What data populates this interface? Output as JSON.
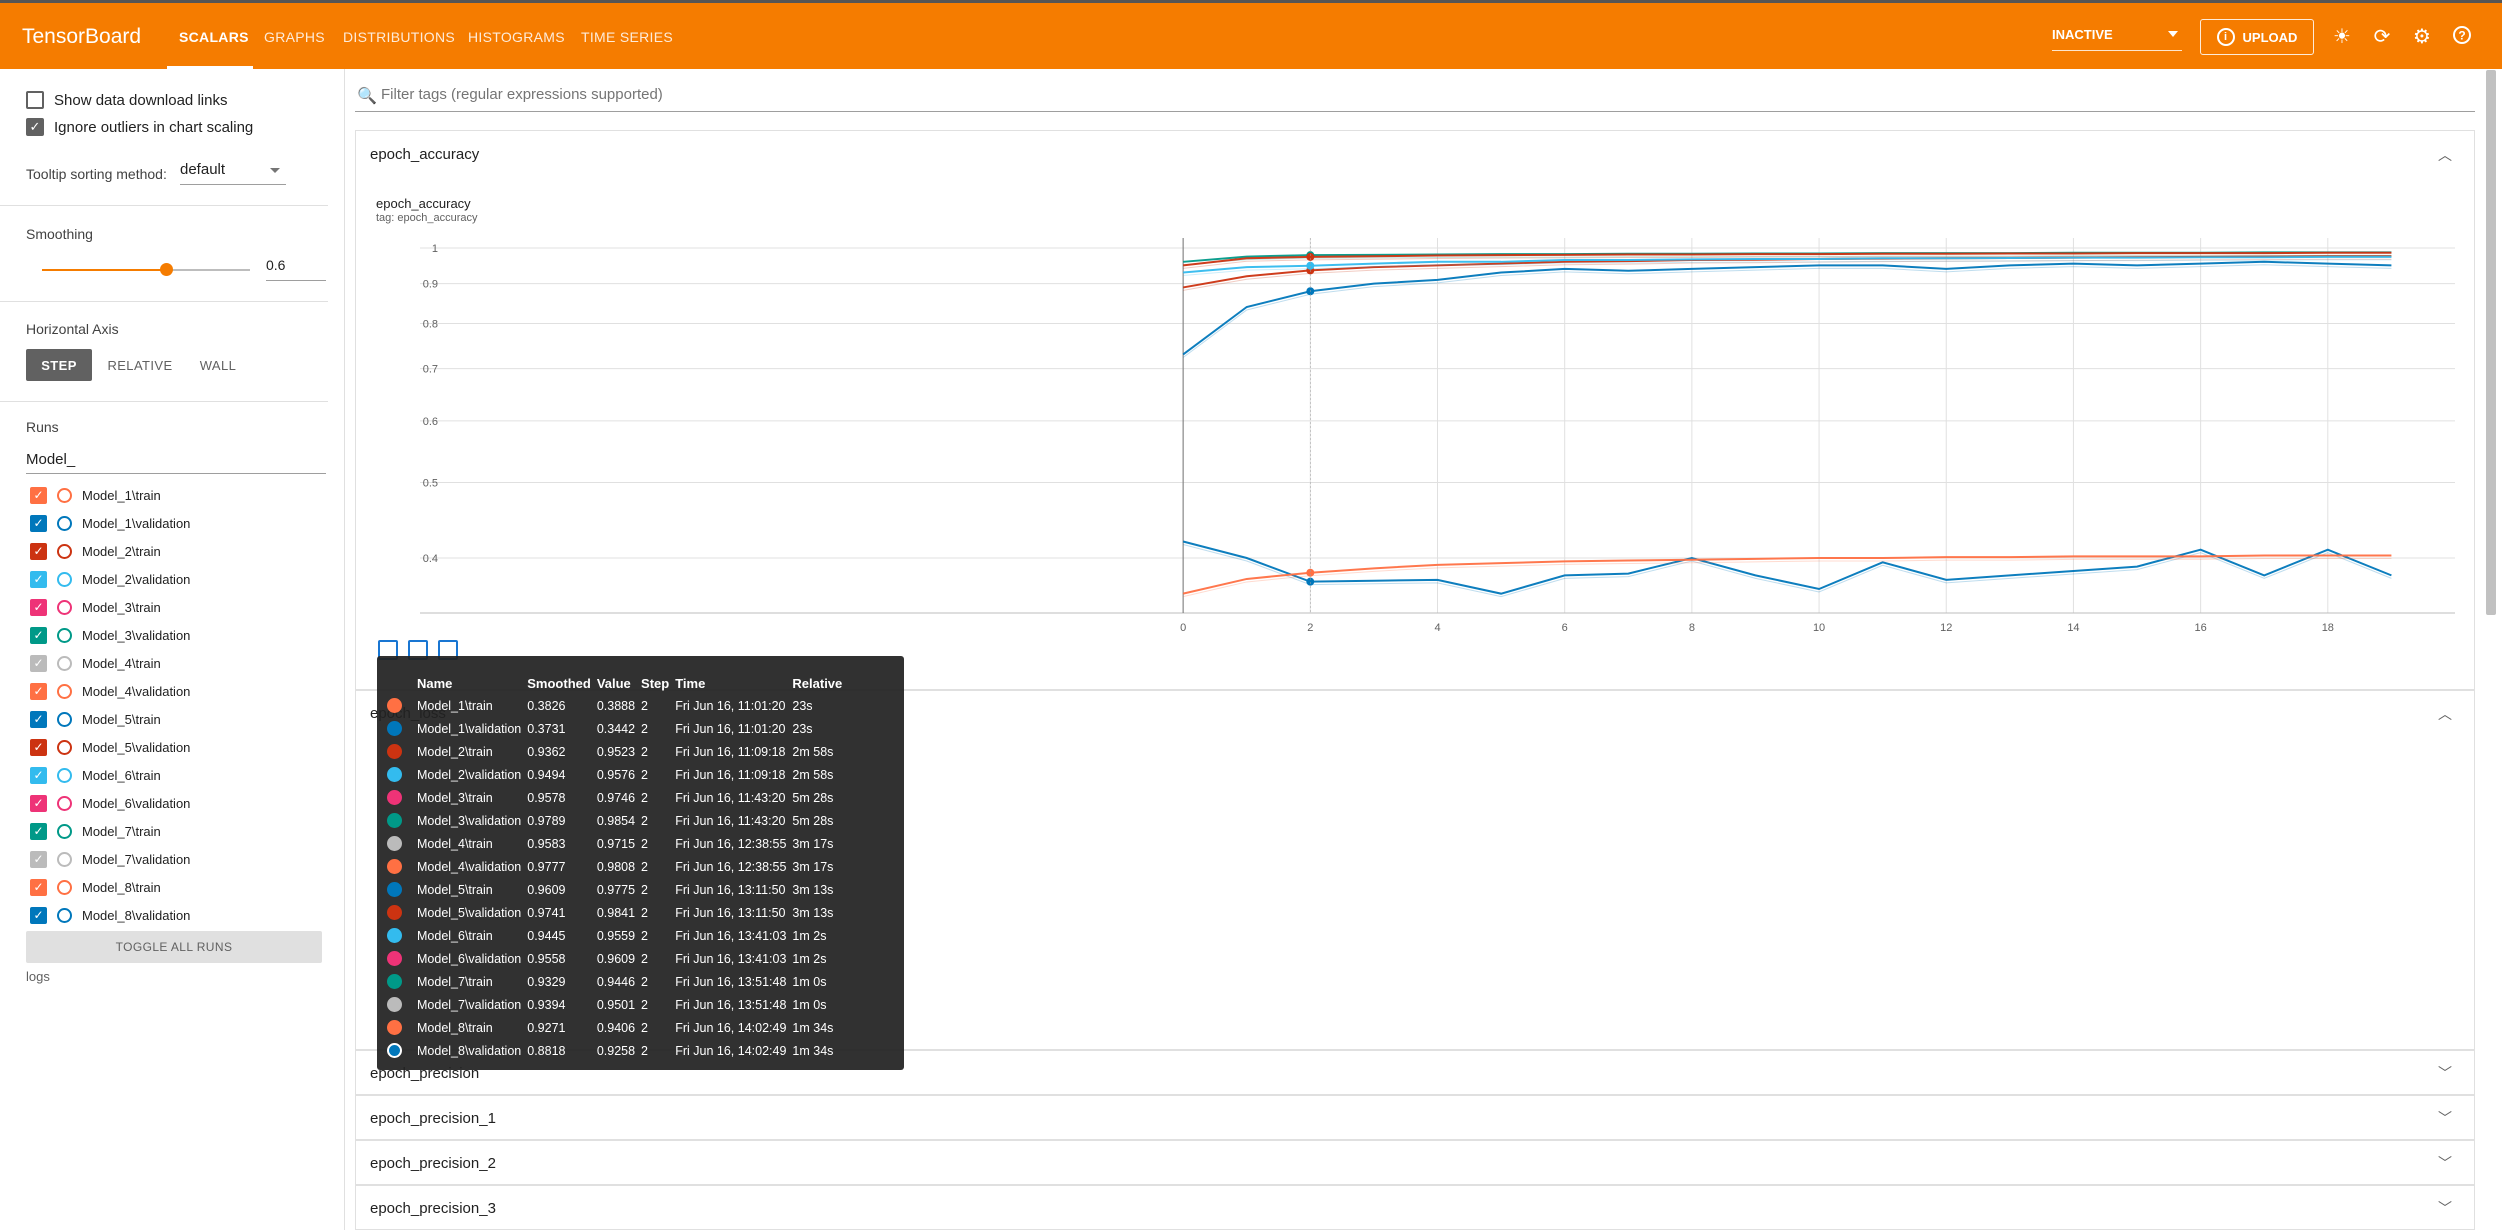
{
  "app": {
    "brand": "TensorBoard",
    "tabs": [
      "SCALARS",
      "GRAPHS",
      "DISTRIBUTIONS",
      "HISTOGRAMS",
      "TIME SERIES"
    ],
    "status_select": "INACTIVE",
    "upload_label": "UPLOAD",
    "accent": "#f57c00"
  },
  "sidebar": {
    "show_download": "Show data download links",
    "ignore_outliers": "Ignore outliers in chart scaling",
    "tooltip_label": "Tooltip sorting method:",
    "tooltip_value": "default",
    "smoothing_label": "Smoothing",
    "smoothing_value": "0.6",
    "smoothing_fraction": 0.6,
    "haxis_label": "Horizontal Axis",
    "haxis_options": [
      "STEP",
      "RELATIVE",
      "WALL"
    ],
    "runs_label": "Runs",
    "runs_filter": "Model_",
    "toggle_all": "TOGGLE ALL RUNS",
    "logdir": "logs",
    "runs": [
      {
        "name": "Model_1\\train",
        "color": "#ff7043"
      },
      {
        "name": "Model_1\\validation",
        "color": "#0077bb"
      },
      {
        "name": "Model_2\\train",
        "color": "#cc3311"
      },
      {
        "name": "Model_2\\validation",
        "color": "#33bbee"
      },
      {
        "name": "Model_3\\train",
        "color": "#ee3377"
      },
      {
        "name": "Model_3\\validation",
        "color": "#009988"
      },
      {
        "name": "Model_4\\train",
        "color": "#bbbbbb"
      },
      {
        "name": "Model_4\\validation",
        "color": "#ff7043"
      },
      {
        "name": "Model_5\\train",
        "color": "#0077bb"
      },
      {
        "name": "Model_5\\validation",
        "color": "#cc3311"
      },
      {
        "name": "Model_6\\train",
        "color": "#33bbee"
      },
      {
        "name": "Model_6\\validation",
        "color": "#ee3377"
      },
      {
        "name": "Model_7\\train",
        "color": "#009988"
      },
      {
        "name": "Model_7\\validation",
        "color": "#bbbbbb"
      },
      {
        "name": "Model_8\\train",
        "color": "#ff7043"
      },
      {
        "name": "Model_8\\validation",
        "color": "#0077bb"
      }
    ]
  },
  "main": {
    "filter_placeholder": "Filter tags (regular expressions supported)",
    "cards": [
      "epoch_accuracy",
      "epoch_loss",
      "epoch_precision",
      "epoch_precision_1",
      "epoch_precision_2",
      "epoch_precision_3"
    ],
    "chart_title": "epoch_accuracy",
    "chart_tag": "tag: epoch_accuracy"
  },
  "chart_data": {
    "type": "line",
    "title": "epoch_accuracy",
    "xlabel": "",
    "ylabel": "",
    "x_ticks": [
      0,
      2,
      4,
      6,
      8,
      10,
      12,
      14,
      16,
      18
    ],
    "y_ticks": [
      0.4,
      0.5,
      0.6,
      0.7,
      0.8,
      0.9,
      1
    ],
    "xlim": [
      -12,
      20
    ],
    "ylim": [
      0.34,
      1.03
    ],
    "y_scale": "log",
    "grid": true,
    "series": [
      {
        "name": "Model_1\\validation",
        "smoothed": [
          0.42,
          0.4,
          0.373,
          0.374,
          0.375,
          0.36,
          0.38,
          0.382,
          0.4,
          0.38,
          0.365,
          0.395,
          0.375,
          0.38,
          0.385,
          0.39,
          0.41,
          0.38,
          0.41,
          0.38
        ]
      },
      {
        "name": "Model_1\\train",
        "smoothed": [
          0.36,
          0.376,
          0.383,
          0.388,
          0.392,
          0.394,
          0.396,
          0.397,
          0.398,
          0.399,
          0.4,
          0.4,
          0.401,
          0.401,
          0.402,
          0.402,
          0.402,
          0.403,
          0.403,
          0.403
        ]
      },
      {
        "name": "Model_8\\validation",
        "smoothed": [
          0.73,
          0.84,
          0.88,
          0.9,
          0.91,
          0.93,
          0.94,
          0.935,
          0.94,
          0.945,
          0.95,
          0.95,
          0.94,
          0.95,
          0.955,
          0.95,
          0.955,
          0.96,
          0.955,
          0.95
        ]
      },
      {
        "name": "Model_2\\train",
        "smoothed": [
          0.89,
          0.92,
          0.936,
          0.945,
          0.95,
          0.955,
          0.96,
          0.962,
          0.965,
          0.966,
          0.968,
          0.969,
          0.97,
          0.971,
          0.972,
          0.973,
          0.974,
          0.975,
          0.976,
          0.976
        ]
      },
      {
        "name": "Model_2\\validation",
        "smoothed": [
          0.93,
          0.945,
          0.949,
          0.955,
          0.96,
          0.96,
          0.965,
          0.965,
          0.967,
          0.968,
          0.968,
          0.97,
          0.97,
          0.971,
          0.972,
          0.972,
          0.973,
          0.973,
          0.974,
          0.974
        ]
      },
      {
        "name": "Model_3\\validation",
        "smoothed": [
          0.96,
          0.975,
          0.979,
          0.98,
          0.981,
          0.982,
          0.982,
          0.983,
          0.983,
          0.984,
          0.984,
          0.985,
          0.985,
          0.985,
          0.986,
          0.986,
          0.986,
          0.987,
          0.987,
          0.987
        ]
      },
      {
        "name": "Model_5\\validation",
        "smoothed": [
          0.95,
          0.97,
          0.974,
          0.976,
          0.978,
          0.979,
          0.98,
          0.981,
          0.981,
          0.982,
          0.982,
          0.983,
          0.983,
          0.984,
          0.984,
          0.985,
          0.985,
          0.985,
          0.986,
          0.986
        ]
      }
    ]
  },
  "tooltip": {
    "headers": [
      "Name",
      "Smoothed",
      "Value",
      "Step",
      "Time",
      "Relative"
    ],
    "rows": [
      {
        "name": "Model_1\\train",
        "smoothed": "0.3826",
        "value": "0.3888",
        "step": "2",
        "time": "Fri Jun 16, 11:01:20",
        "relative": "23s",
        "color": "#ff7043",
        "ring": false
      },
      {
        "name": "Model_1\\validation",
        "smoothed": "0.3731",
        "value": "0.3442",
        "step": "2",
        "time": "Fri Jun 16, 11:01:20",
        "relative": "23s",
        "color": "#0077bb",
        "ring": false
      },
      {
        "name": "Model_2\\train",
        "smoothed": "0.9362",
        "value": "0.9523",
        "step": "2",
        "time": "Fri Jun 16, 11:09:18",
        "relative": "2m 58s",
        "color": "#cc3311",
        "ring": false
      },
      {
        "name": "Model_2\\validation",
        "smoothed": "0.9494",
        "value": "0.9576",
        "step": "2",
        "time": "Fri Jun 16, 11:09:18",
        "relative": "2m 58s",
        "color": "#33bbee",
        "ring": false
      },
      {
        "name": "Model_3\\train",
        "smoothed": "0.9578",
        "value": "0.9746",
        "step": "2",
        "time": "Fri Jun 16, 11:43:20",
        "relative": "5m 28s",
        "color": "#ee3377",
        "ring": false
      },
      {
        "name": "Model_3\\validation",
        "smoothed": "0.9789",
        "value": "0.9854",
        "step": "2",
        "time": "Fri Jun 16, 11:43:20",
        "relative": "5m 28s",
        "color": "#009988",
        "ring": false
      },
      {
        "name": "Model_4\\train",
        "smoothed": "0.9583",
        "value": "0.9715",
        "step": "2",
        "time": "Fri Jun 16, 12:38:55",
        "relative": "3m 17s",
        "color": "#bbbbbb",
        "ring": false
      },
      {
        "name": "Model_4\\validation",
        "smoothed": "0.9777",
        "value": "0.9808",
        "step": "2",
        "time": "Fri Jun 16, 12:38:55",
        "relative": "3m 17s",
        "color": "#ff7043",
        "ring": false
      },
      {
        "name": "Model_5\\train",
        "smoothed": "0.9609",
        "value": "0.9775",
        "step": "2",
        "time": "Fri Jun 16, 13:11:50",
        "relative": "3m 13s",
        "color": "#0077bb",
        "ring": false
      },
      {
        "name": "Model_5\\validation",
        "smoothed": "0.9741",
        "value": "0.9841",
        "step": "2",
        "time": "Fri Jun 16, 13:11:50",
        "relative": "3m 13s",
        "color": "#cc3311",
        "ring": false
      },
      {
        "name": "Model_6\\train",
        "smoothed": "0.9445",
        "value": "0.9559",
        "step": "2",
        "time": "Fri Jun 16, 13:41:03",
        "relative": "1m 2s",
        "color": "#33bbee",
        "ring": false
      },
      {
        "name": "Model_6\\validation",
        "smoothed": "0.9558",
        "value": "0.9609",
        "step": "2",
        "time": "Fri Jun 16, 13:41:03",
        "relative": "1m 2s",
        "color": "#ee3377",
        "ring": false
      },
      {
        "name": "Model_7\\train",
        "smoothed": "0.9329",
        "value": "0.9446",
        "step": "2",
        "time": "Fri Jun 16, 13:51:48",
        "relative": "1m 0s",
        "color": "#009988",
        "ring": false
      },
      {
        "name": "Model_7\\validation",
        "smoothed": "0.9394",
        "value": "0.9501",
        "step": "2",
        "time": "Fri Jun 16, 13:51:48",
        "relative": "1m 0s",
        "color": "#bbbbbb",
        "ring": false
      },
      {
        "name": "Model_8\\train",
        "smoothed": "0.9271",
        "value": "0.9406",
        "step": "2",
        "time": "Fri Jun 16, 14:02:49",
        "relative": "1m 34s",
        "color": "#ff7043",
        "ring": false
      },
      {
        "name": "Model_8\\validation",
        "smoothed": "0.8818",
        "value": "0.9258",
        "step": "2",
        "time": "Fri Jun 16, 14:02:49",
        "relative": "1m 34s",
        "color": "#0077bb",
        "ring": true
      }
    ]
  }
}
